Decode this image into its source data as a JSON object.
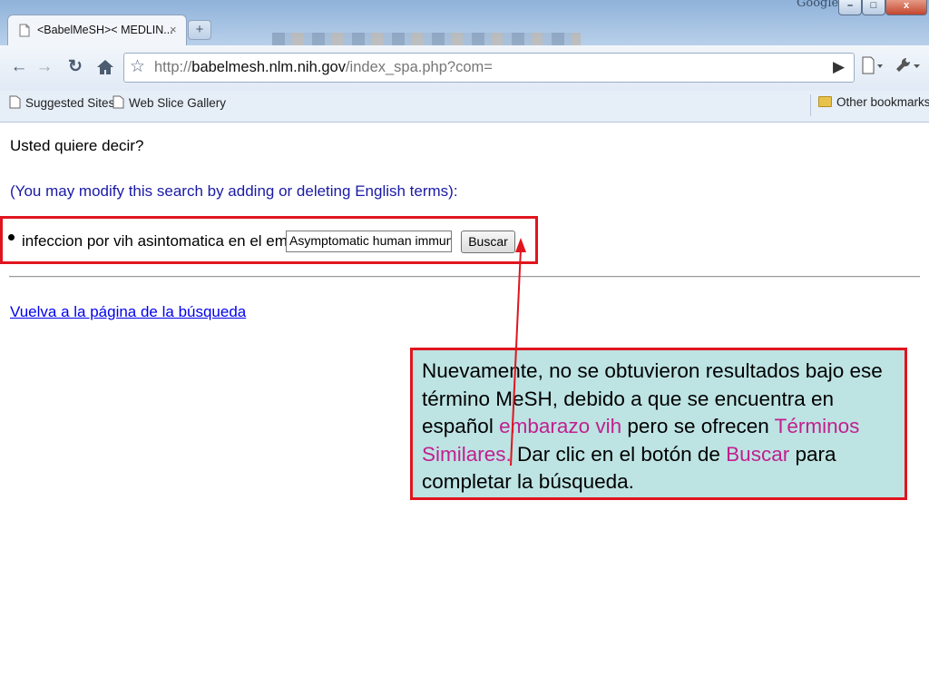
{
  "browser": {
    "corner_label": "Google",
    "window_controls": {
      "minimize": "–",
      "maximize": "□",
      "close": "x"
    },
    "tab": {
      "title": "<BabelMeSH>< MEDLIN...",
      "close": "×"
    },
    "new_tab": "+",
    "url": {
      "scheme": "http://",
      "domain": "babelmesh.nlm.nih.gov",
      "path": "/index_spa.php?com="
    },
    "bookmarks": [
      {
        "label": "Suggested Sites",
        "icon": "page-icon"
      },
      {
        "label": "Web Slice Gallery",
        "icon": "page-icon"
      }
    ],
    "other_bookmarks": "Other bookmarks"
  },
  "page": {
    "question": "Usted quiere decir?",
    "hint": "(You may modify this search by adding or deleting English terms):",
    "term_label": "infeccion por vih asintomatica en el embarazo =",
    "term_value": "Asymptomatic human immunodeficiency virus infection in pregnancy",
    "search_button": "Buscar",
    "back_link": "Vuelva a la página de la búsqueda"
  },
  "callout": {
    "parts": [
      "Nuevamente, no se obtuvieron resultados bajo ese término MeSH, debido a que se encuentra en español ",
      "embarazo vih",
      " pero se ofrecen ",
      "Términos Similares.",
      " Dar clic en el botón de ",
      "Buscar",
      " para completar la búsqueda."
    ],
    "highlight_color": "#c0208e",
    "border_color": "#e0151e",
    "background": "#bde3e3"
  }
}
